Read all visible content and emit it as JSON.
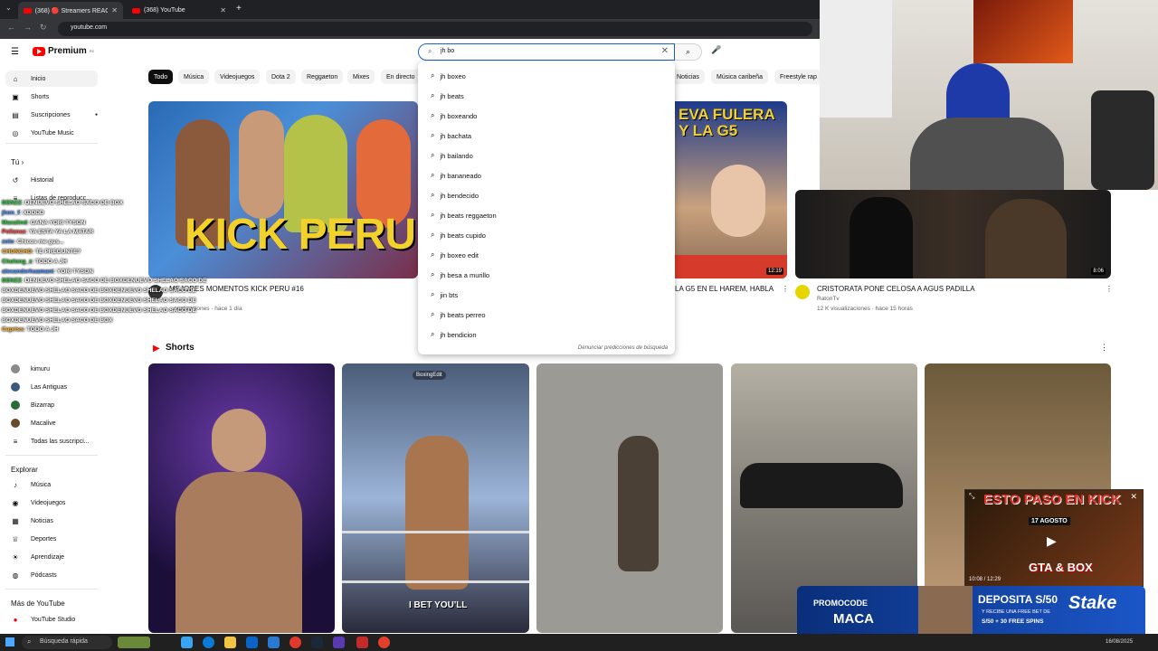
{
  "browser": {
    "tabs": [
      {
        "label": "(368) 🔴 Streamers REACCIONA"
      },
      {
        "label": "(368) YouTube"
      }
    ],
    "url": "youtube.com"
  },
  "header": {
    "logo": "Premium",
    "logo_sup": "PE",
    "search_value": "jh bo",
    "icons": [
      "menu-icon",
      "search-icon",
      "mic-icon",
      "clear-icon"
    ]
  },
  "sidebar": {
    "main": [
      {
        "label": "Inicio",
        "icon": "home-icon"
      },
      {
        "label": "Shorts",
        "icon": "shorts-icon"
      },
      {
        "label": "Suscripciones",
        "icon": "subscriptions-icon"
      },
      {
        "label": "YouTube Music",
        "icon": "music-icon"
      }
    ],
    "you_label": "Tú",
    "you_items": [
      {
        "label": "Historial"
      },
      {
        "label": "Listas de reproducc..."
      }
    ],
    "subs": [
      {
        "label": "kimuru"
      },
      {
        "label": "Las Antiguas"
      },
      {
        "label": "Bizarrap"
      },
      {
        "label": "Macalive"
      },
      {
        "label": "Todas las suscripci..."
      }
    ],
    "explore_label": "Explorar",
    "explore": [
      {
        "label": "Música"
      },
      {
        "label": "Videojuegos"
      },
      {
        "label": "Noticias"
      },
      {
        "label": "Deportes"
      },
      {
        "label": "Aprendizaje"
      },
      {
        "label": "Pódcasts"
      }
    ],
    "more_label": "Más de YouTube",
    "more": [
      {
        "label": "YouTube Studio"
      }
    ]
  },
  "chips": [
    "Todo",
    "Música",
    "Videojuegos",
    "Dota 2",
    "Reggaeton",
    "Mixes",
    "En directo",
    "Noticias",
    "Música caribeña",
    "Freestyle rap"
  ],
  "videos": [
    {
      "title": "MEJORES MOMENTOS KICK PERU #16",
      "meta": "...sualizaciones · hace 1 día",
      "thumb_text": "KICK PERU"
    },
    {
      "title": "LA G5 EN EL HAREM, HABLA",
      "duration": "12:19",
      "thumb_text": "EVA FULERA Y LA G5"
    },
    {
      "title": "CRISTORATA PONE CELOSA A AGUS PADILLA",
      "channel": "RatonTv",
      "meta": "12 K visualizaciones · hace 15 horas",
      "duration": "8:06"
    }
  ],
  "shorts_label": "Shorts",
  "shorts": [
    {
      "caption": ""
    },
    {
      "caption": "I BET YOU'LL",
      "badge": "BoxingEdit"
    },
    {
      "caption": ""
    },
    {
      "caption": ""
    },
    {
      "caption": "ESTO PASO EN KICK"
    }
  ],
  "suggestions": [
    "jh boxeo",
    "jh beats",
    "jh boxeando",
    "jh bachata",
    "jh bailando",
    "jh bananeado",
    "jh bendecido",
    "jh beats reggaeton",
    "jh beats cupido",
    "jh boxeo edit",
    "jh besa a murillo",
    "jin bts",
    "jh beats perreo",
    "jh bendicion"
  ],
  "report_predictions": "Denunciar predicciones de búsqueda",
  "chat": [
    {
      "user": "DENZZ",
      "msg": ": DENUEVO SHELAO SACO DE BOX"
    },
    {
      "user": "jhon_f",
      "msg": ": XDDDD"
    },
    {
      "user": "Maxalind",
      "msg": ": GANA YORI TYSON"
    },
    {
      "user": "Pollanaz",
      "msg": ": YA ESTA YA LA MATAR"
    },
    {
      "user": "zolo",
      "msg": ": Chicos me gus..."
    },
    {
      "user": "CHUNCHO",
      "msg": ": TE PREGUNTE?"
    },
    {
      "user": "Cholong_z",
      "msg": ": TODO A JH"
    },
    {
      "user": "alexanderhuamani",
      "msg": ": YORI TYSON"
    },
    {
      "user": "DENZZ",
      "msg": ": DENUEVO SHELAO SACO DE BOXDENUEVO SHELAO SACO DE"
    },
    {
      "user": "",
      "msg": "BOXDENUEVO SHELAO SACO DE BOXDENUEVO SHELAO SACO DE"
    },
    {
      "user": "",
      "msg": "BOXDENUEVO SHELAO SACO DE BOXDENUEVO SHELAO SACO DE"
    },
    {
      "user": "",
      "msg": "BOXDENUEVO SHELAO SACO DE BOXDENUEVO SHELAO SACO DE"
    },
    {
      "user": "",
      "msg": "BOXDENUEVO SHELAO SACO DE BOX"
    },
    {
      "user": "Capriss",
      "msg": ": TODO A JH"
    }
  ],
  "pip": {
    "time": "10:08 / 12:29",
    "date": "17 AGOSTO",
    "caption": "GTA & BOX"
  },
  "ad": {
    "promo_label": "PROMOCODE",
    "promo_code": "MACA",
    "line1": "DEPOSITA S/50",
    "line2": "Y RECIBE UNA FREE BET DE",
    "line3": "S/50 + 30 FREE SPINS",
    "brand": "Stake"
  },
  "taskbar": {
    "search": "Búsqueda rápida",
    "date": "16/08/2025"
  },
  "colors": {
    "brand_red": "#ff0000",
    "stake_blue": "#0a3fa8"
  }
}
